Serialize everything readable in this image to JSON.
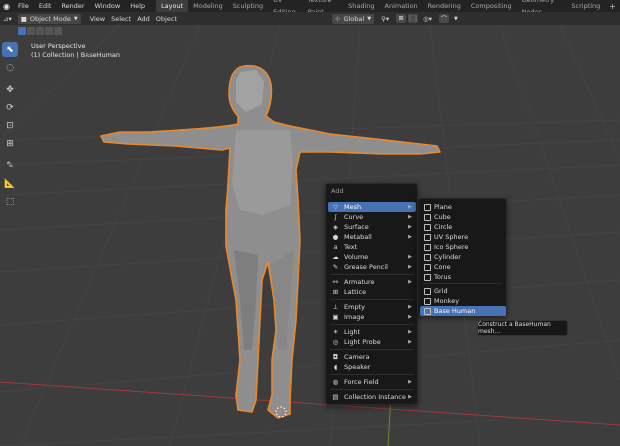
{
  "top_menu": [
    "File",
    "Edit",
    "Render",
    "Window",
    "Help"
  ],
  "workspace_tabs": [
    {
      "label": "Layout",
      "active": true
    },
    {
      "label": "Modeling"
    },
    {
      "label": "Sculpting"
    },
    {
      "label": "UV Editing"
    },
    {
      "label": "Texture Paint"
    },
    {
      "label": "Shading"
    },
    {
      "label": "Animation"
    },
    {
      "label": "Rendering"
    },
    {
      "label": "Compositing"
    },
    {
      "label": "Geometry Nodes"
    },
    {
      "label": "Scripting"
    }
  ],
  "add_tab_glyph": "+",
  "header": {
    "mode": "Object Mode",
    "view": "View",
    "select": "Select",
    "add": "Add",
    "object": "Object",
    "transform_orientation": "Global"
  },
  "viewport": {
    "perspective": "User Perspective",
    "collection": "(1) Collection | BaseHuman"
  },
  "add_menu": {
    "title": "Add",
    "items": [
      {
        "label": "Mesh",
        "icon": "triangle-mesh-icon",
        "glyph": "▽",
        "submenu": true,
        "highlighted": true
      },
      {
        "label": "Curve",
        "icon": "curve-icon",
        "glyph": "∫",
        "submenu": true
      },
      {
        "label": "Surface",
        "icon": "surface-icon",
        "glyph": "◈",
        "submenu": true
      },
      {
        "label": "Metaball",
        "icon": "metaball-icon",
        "glyph": "●",
        "submenu": true
      },
      {
        "label": "Text",
        "icon": "text-icon",
        "glyph": "a"
      },
      {
        "label": "Volume",
        "icon": "volume-icon",
        "glyph": "☁",
        "submenu": true
      },
      {
        "label": "Grease Pencil",
        "icon": "grease-pencil-icon",
        "glyph": "✎",
        "submenu": true
      },
      {
        "label": "Armature",
        "icon": "armature-icon",
        "glyph": "⚯",
        "submenu": true
      },
      {
        "label": "Lattice",
        "icon": "lattice-icon",
        "glyph": "⊞"
      },
      {
        "label": "Empty",
        "icon": "empty-icon",
        "glyph": "⊥",
        "submenu": true
      },
      {
        "label": "Image",
        "icon": "image-icon",
        "glyph": "▣",
        "submenu": true
      },
      {
        "label": "Light",
        "icon": "light-icon",
        "glyph": "☀",
        "submenu": true
      },
      {
        "label": "Light Probe",
        "icon": "light-probe-icon",
        "glyph": "◎",
        "submenu": true
      },
      {
        "label": "Camera",
        "icon": "camera-icon",
        "glyph": "◘"
      },
      {
        "label": "Speaker",
        "icon": "speaker-icon",
        "glyph": "◖"
      },
      {
        "label": "Force Field",
        "icon": "force-field-icon",
        "glyph": "◍",
        "submenu": true
      },
      {
        "label": "Collection Instance",
        "icon": "collection-instance-icon",
        "glyph": "▤",
        "submenu": true
      }
    ]
  },
  "mesh_menu": {
    "items": [
      {
        "label": "Plane",
        "icon": "plane-icon"
      },
      {
        "label": "Cube",
        "icon": "cube-icon"
      },
      {
        "label": "Circle",
        "icon": "circle-icon"
      },
      {
        "label": "UV Sphere",
        "icon": "uv-sphere-icon"
      },
      {
        "label": "Ico Sphere",
        "icon": "ico-sphere-icon"
      },
      {
        "label": "Cylinder",
        "icon": "cylinder-icon"
      },
      {
        "label": "Cone",
        "icon": "cone-icon"
      },
      {
        "label": "Torus",
        "icon": "torus-icon"
      },
      {
        "label": "Grid",
        "icon": "grid-icon"
      },
      {
        "label": "Monkey",
        "icon": "monkey-icon"
      },
      {
        "label": "Base Human",
        "icon": "base-human-icon",
        "highlighted": true
      }
    ]
  },
  "tooltip": "Construct a BaseHuman mesh...",
  "colors": {
    "accent": "#4772b3",
    "selection_outline": "#e9892b",
    "axis_x": "#9e3a3a",
    "axis_y": "#6a8c2d"
  }
}
